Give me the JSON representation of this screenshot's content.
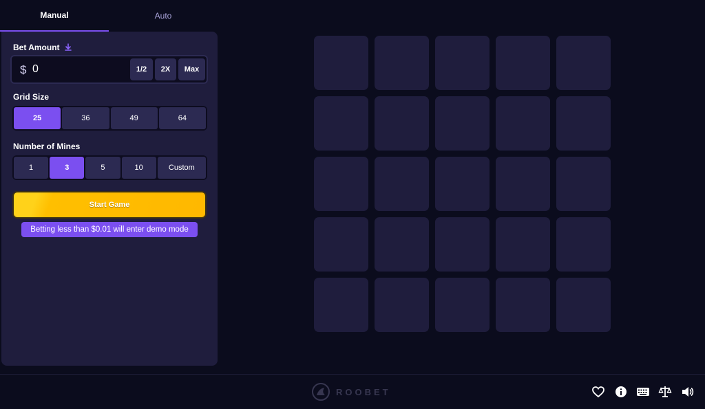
{
  "tabs": [
    {
      "label": "Manual",
      "active": true
    },
    {
      "label": "Auto",
      "active": false
    }
  ],
  "bet": {
    "label": "Bet Amount",
    "currency": "$",
    "value": "0",
    "buttons": [
      "1/2",
      "2X",
      "Max"
    ]
  },
  "grid_size": {
    "label": "Grid Size",
    "options": [
      "25",
      "36",
      "49",
      "64"
    ],
    "selected": "25"
  },
  "mines": {
    "label": "Number of Mines",
    "options": [
      "1",
      "3",
      "5",
      "10",
      "Custom"
    ],
    "selected": "3"
  },
  "start_button": "Start Game",
  "demo_note": "Betting less than $0.01 will enter demo mode",
  "board": {
    "rows": 5,
    "cols": 5
  },
  "footer": {
    "logo_text": "ROOBET",
    "icons": [
      "heart-icon",
      "info-icon",
      "keyboard-icon",
      "scale-icon",
      "speaker-icon"
    ]
  },
  "colors": {
    "background": "#0b0c1d",
    "panel": "#1f1d3d",
    "accent": "#7b4ff0",
    "start": "#ffb800"
  }
}
